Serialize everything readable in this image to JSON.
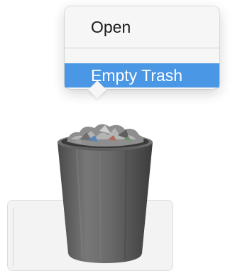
{
  "context_menu": {
    "items": [
      {
        "label": "Open"
      },
      {
        "label": "Empty Trash",
        "highlighted": true
      }
    ],
    "highlight_color": "#4a97e6"
  },
  "dock_item": {
    "icon": "trash-full-icon"
  }
}
